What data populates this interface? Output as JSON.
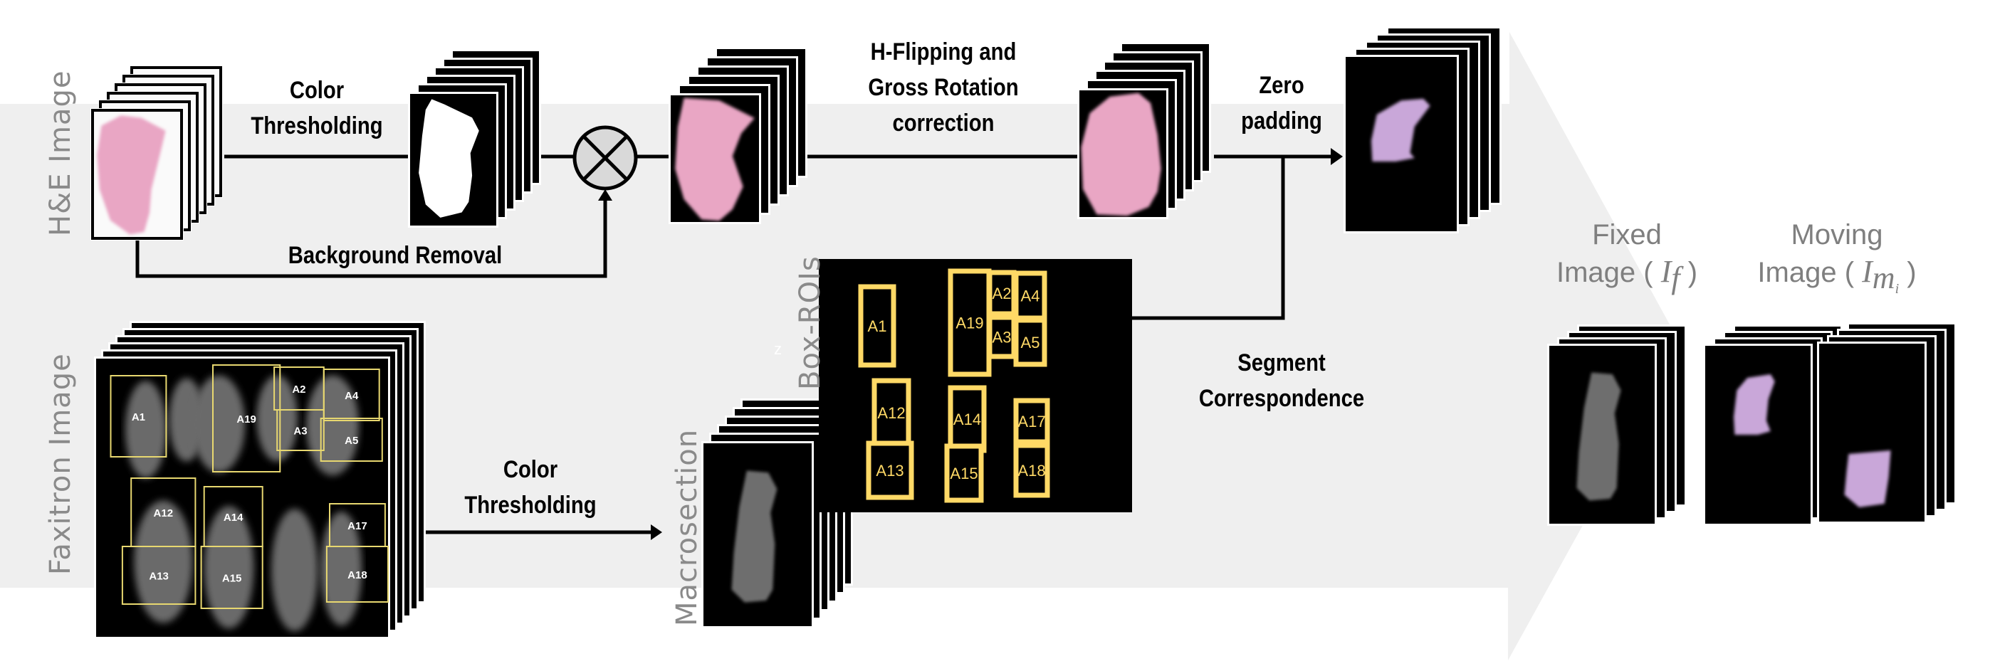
{
  "figure": {
    "description": "Pipeline for registering H&E histology images to Faxitron X-ray macrosection images",
    "colors": {
      "background_arrow": "#efefef",
      "roi_box": "#ffd966",
      "roi_box_faxitron": "#e8d870",
      "he_tissue": "#e9a6c4",
      "he_tissue_zero_padded": "#c9a7d9",
      "xray_tissue": "#6e6e6e",
      "connector": "#000000",
      "multiply_node_fill": "#d9d9d9",
      "label_gray": "#8a8a8a"
    }
  },
  "inputs": {
    "he_image_label": "H&E Image",
    "faxitron_image_label": "Faxitron Image"
  },
  "steps": {
    "color_thresholding_top": [
      "Color",
      "Thresholding"
    ],
    "background_removal": "Background Removal",
    "multiply_node": "multiply-operator",
    "flip_rotation": [
      "H-Flipping and",
      "Gross Rotation",
      "correction"
    ],
    "zero_padding": [
      "Zero",
      "padding"
    ],
    "color_thresholding_bottom": [
      "Color",
      "Thresholding"
    ],
    "segment_correspondence": [
      "Segment",
      "Correspondence"
    ]
  },
  "intermediate": {
    "macrosection_label": "Macrosection",
    "box_rois_label": "Box-ROIs",
    "stray_glyph": "z"
  },
  "rois": {
    "faxitron": [
      "A1",
      "A19",
      "A2",
      "A3",
      "A4",
      "A5",
      "A12",
      "A13",
      "A14",
      "A15",
      "A17",
      "A18"
    ],
    "box_panel": [
      "A1",
      "A19",
      "A2",
      "A4",
      "A3",
      "A5",
      "A12",
      "A14",
      "A17",
      "A13",
      "A15",
      "A18"
    ]
  },
  "outputs": {
    "fixed": {
      "line1": "Fixed",
      "line2_prefix": "Image ( ",
      "symbol": "I",
      "subscript": "f",
      "suffix": " )"
    },
    "moving": {
      "line1": "Moving",
      "line2_prefix": "Image ( ",
      "symbol": "I",
      "subscript": "m",
      "subsub": "i",
      "suffix": " )"
    }
  }
}
